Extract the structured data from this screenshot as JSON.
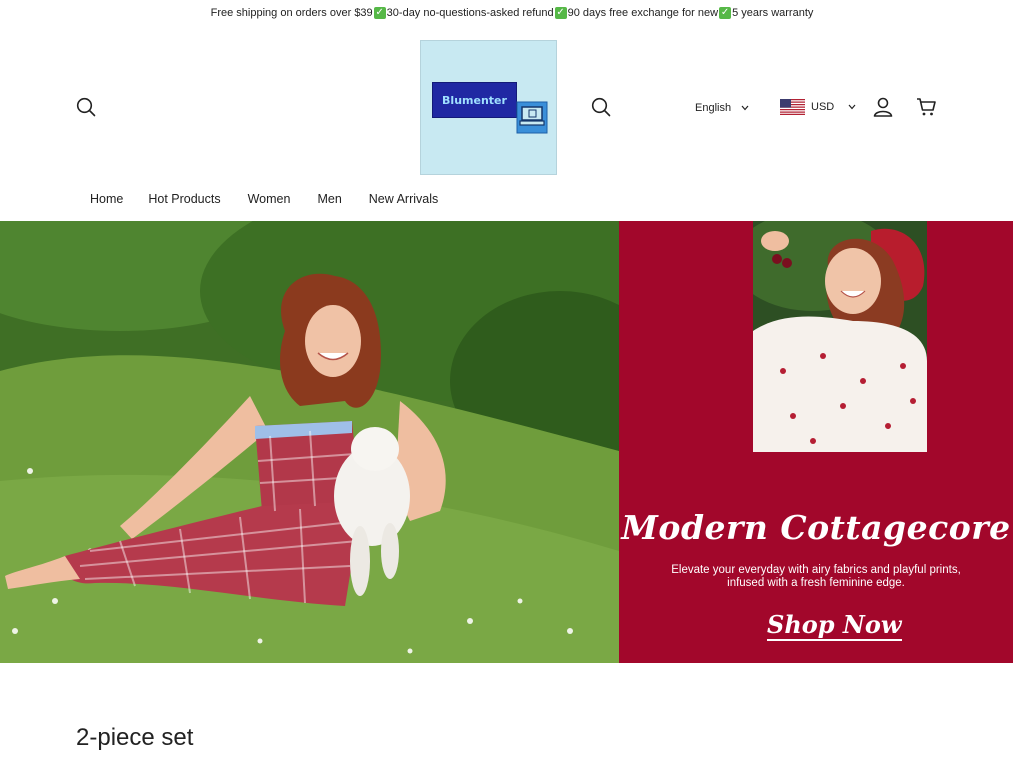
{
  "announcement": {
    "part1": "Free shipping on orders over $39",
    "part2": "30-day no-questions-asked refund",
    "part3": "90 days free exchange for new",
    "part4": "5 years warranty",
    "check_glyph": "✓"
  },
  "header": {
    "logo_text": "Blumenter",
    "language": "English",
    "currency": "USD",
    "icons": [
      "search-icon",
      "search-icon",
      "account-icon",
      "cart-icon",
      "chevron-down-icon",
      "us-flag-icon"
    ]
  },
  "nav": {
    "items": [
      "Home",
      "Hot Products",
      "Women",
      "Men",
      "New Arrivals"
    ]
  },
  "hero": {
    "title": "Modern Cottagecore",
    "subtitle_line1": "Elevate your everyday with airy fabrics and playful prints,",
    "subtitle_line2": "infused with a fresh feminine edge.",
    "cta": "Shop Now"
  },
  "section": {
    "title": "2-piece set"
  },
  "colors": {
    "hero_panel": "#a2072b",
    "logo_bg": "#c8e9f2",
    "logo_plate": "#2028a3",
    "check": "#56b847"
  }
}
